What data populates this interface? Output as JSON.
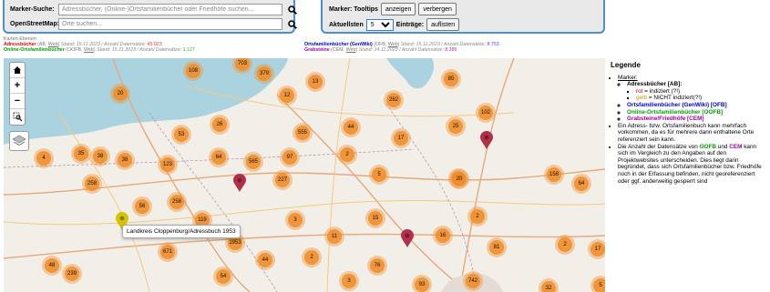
{
  "search": {
    "marker_label": "Marker-Suche:",
    "marker_placeholder": "Adressbücher, (Online-)Ortsfamilienbücher oder Friedhöfe suchen...",
    "osm_label": "OpenStreetMap:",
    "osm_placeholder": "Orte suchen..."
  },
  "controls": {
    "tooltips_label": "Marker: Tooltips",
    "show_button": "anzeigen",
    "hide_button": "verbergen",
    "latest_label": "Aktuellsten",
    "latest_value": "5",
    "entries_label": "Einträge:",
    "list_button": "auflisten"
  },
  "layers": {
    "heading": "Karten-Ebenen:",
    "ab": {
      "name": "Adressbücher",
      "abbr": "(AB,",
      "wiki": "Web",
      "stand": "Stand: 15.11.2023 / Anzahl Datensätze:",
      "count": "45.023"
    },
    "oofb": {
      "name": "Online-Ortsfamilienbücher",
      "abbr": "(OOFB,",
      "wiki": "Web",
      "stand": "Stand: 15.11.2023 / Anzahl Datensätze:",
      "count": "1.127"
    },
    "ofb": {
      "name": "Ortsfamilienbücher (GenWiki)",
      "abbr": "(OFB,",
      "wiki": "Web",
      "stand": "Stand: 15.11.2023 / Anzahl Datensätze:",
      "count": "8.753"
    },
    "cem": {
      "name": "Grabsteine",
      "abbr": "(CEM,",
      "wiki": "Web",
      "stand": "Stand: 14.11.2023 / Anzahl Datensätze:",
      "count": "8.385"
    }
  },
  "map": {
    "zoom_in": "+",
    "zoom_out": "−",
    "tooltip": "Landkreis Cloppenburg/Adressbuch 1953",
    "clusters": [
      "703",
      "379",
      "108",
      "20",
      "12",
      "13",
      "85",
      "262",
      "102",
      "53",
      "26",
      "555",
      "44",
      "17",
      "25",
      "35",
      "38",
      "4",
      "38",
      "123",
      "64",
      "565",
      "97",
      "2",
      "20",
      "258",
      "227",
      "56",
      "258",
      "5",
      "20",
      "158",
      "64",
      "119",
      "3",
      "15",
      "2",
      "1953",
      "11",
      "16",
      "671",
      "81",
      "2",
      "17",
      "44",
      "2",
      "48",
      "239",
      "54",
      "76",
      "742",
      "3",
      "93",
      "32",
      "5"
    ]
  },
  "legend": {
    "title": "Legende",
    "marker_label": "Marker:",
    "ab_label": "Adressbücher [AB]:",
    "rot": "rot",
    "rot_text": "= indiziert (?!)",
    "gelb": "gelb",
    "gelb_text": "= NICHT indiziert(?!)",
    "ofb_label": "Ortsfamilienbücher (GenWiki) [OFB]",
    "oofb_label": "Online-Ortsfamilienbücher [OOFB]",
    "cem_label": "Grabsteine/Friedhöfe [CEM]",
    "note1": "Ein Adress- bzw. Ortsfamilienbuch kann mehrfach vorkommen, da es für mehrere darin enthaltene Orte referenziert sein kann.",
    "note2_a": "Die Anzahl der Datensätze von",
    "note2_oofb": "OOFB",
    "note2_und": "und",
    "note2_cem": "CEM",
    "note2_b": "kann sich im Vergleich zu den Angaben auf den Projektwebsites unterscheiden. Dies liegt darin begründet, dass sich Ortsfamilienbücher bzw. Friedhöfe noch in der Erfassung befinden, nicht georeferenziert oder ggf. anderweitig gesperrt sind"
  },
  "colors": {
    "accent": "#4a8fd0",
    "cluster": "#f08c28",
    "pin_red": "#b0304a",
    "pin_yellow": "#d4c400"
  }
}
